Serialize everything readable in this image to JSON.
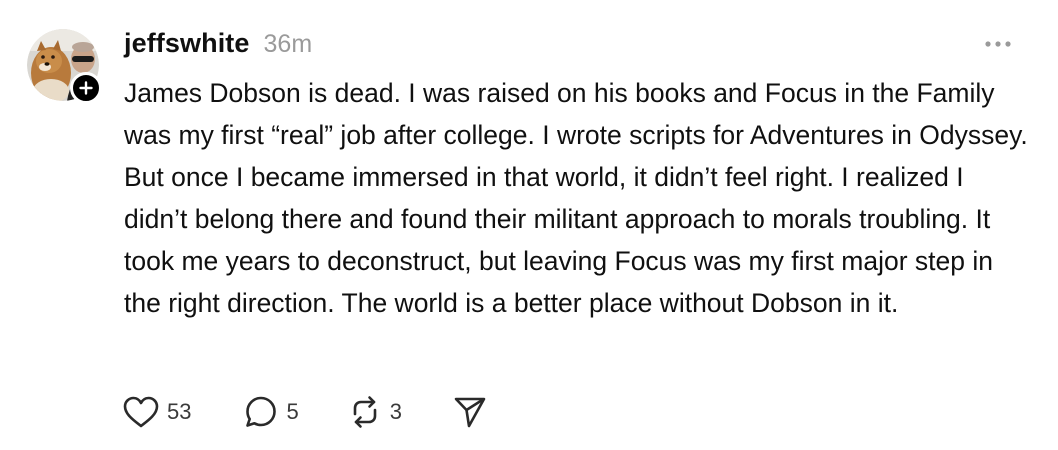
{
  "post": {
    "username": "jeffswhite",
    "timestamp": "36m",
    "body": "James Dobson is dead. I was raised on his books and Focus in the Family was my first “real” job after college. I wrote scripts for Adventures in Odyssey. But once I became immersed in that world, it didn’t feel right. I realized I didn’t belong there and found their militant approach to morals troubling. It took me years to deconstruct, but leaving Focus was my first major step in the right direction. The world is a better place without Dobson in it.",
    "avatar_icon": "profile-photo",
    "follow_icon": "plus-icon",
    "more_icon": "ellipsis-icon"
  },
  "actions": {
    "like": {
      "icon": "heart-icon",
      "count": "53"
    },
    "reply": {
      "icon": "comment-icon",
      "count": "5"
    },
    "repost": {
      "icon": "repost-icon",
      "count": "3"
    },
    "share": {
      "icon": "send-icon"
    }
  },
  "colors": {
    "text": "#101010",
    "muted": "#9a9a9a",
    "icon": "#3a3a3a",
    "background": "#ffffff"
  }
}
